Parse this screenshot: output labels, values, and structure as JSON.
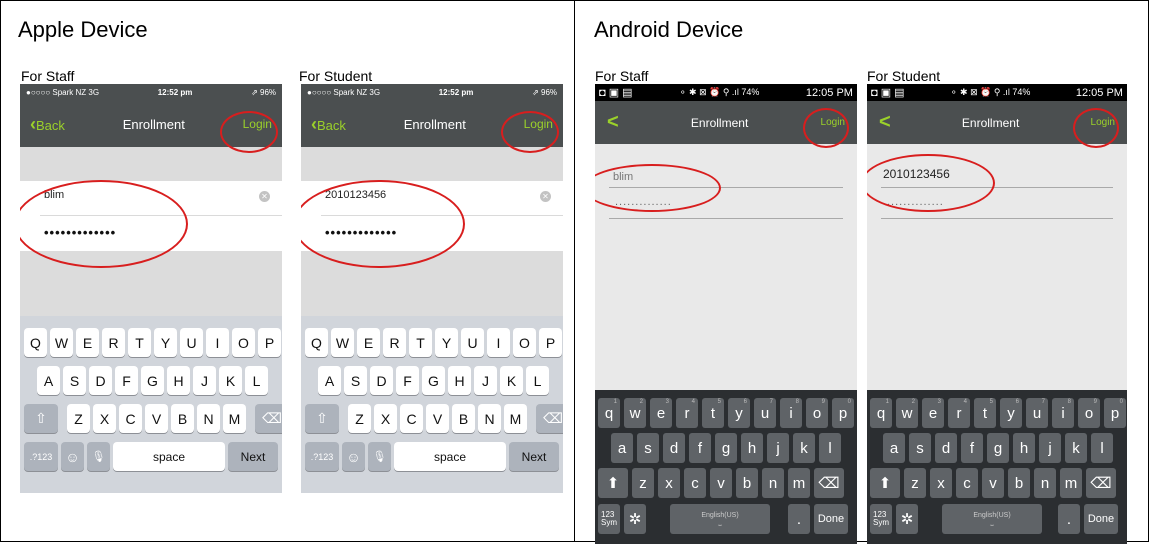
{
  "apple": {
    "title": "Apple Device",
    "staff": {
      "label": "For Staff",
      "statusbar": {
        "left": "●○○○○ Spark NZ  3G",
        "time": "12:52 pm",
        "right": "⇗ 96%"
      },
      "nav": {
        "back": "Back",
        "title": "Enrollment",
        "login": "Login"
      },
      "username": "blim",
      "password": "•••••••••••••",
      "keyboard": {
        "row1": [
          "Q",
          "W",
          "E",
          "R",
          "T",
          "Y",
          "U",
          "I",
          "O",
          "P"
        ],
        "row2": [
          "A",
          "S",
          "D",
          "F",
          "G",
          "H",
          "J",
          "K",
          "L"
        ],
        "row3": [
          "Z",
          "X",
          "C",
          "V",
          "B",
          "N",
          "M"
        ],
        "numkey": ".?123",
        "emoji": "☺",
        "mic": "🎙",
        "space": "space",
        "next": "Next",
        "shift": "⇧",
        "delete": "⌫"
      }
    },
    "student": {
      "label": "For Student",
      "statusbar": {
        "left": "●○○○○ Spark NZ  3G",
        "time": "12:52 pm",
        "right": "⇗ 96%"
      },
      "nav": {
        "back": "Back",
        "title": "Enrollment",
        "login": "Login"
      },
      "username": "2010123456",
      "password": "•••••••••••••",
      "keyboard": {
        "row1": [
          "Q",
          "W",
          "E",
          "R",
          "T",
          "Y",
          "U",
          "I",
          "O",
          "P"
        ],
        "row2": [
          "A",
          "S",
          "D",
          "F",
          "G",
          "H",
          "J",
          "K",
          "L"
        ],
        "row3": [
          "Z",
          "X",
          "C",
          "V",
          "B",
          "N",
          "M"
        ],
        "numkey": ".?123",
        "emoji": "☺",
        "mic": "🎙",
        "space": "space",
        "next": "Next",
        "shift": "⇧",
        "delete": "⌫"
      }
    }
  },
  "android": {
    "title": "Android Device",
    "staff": {
      "label": "For Staff",
      "statusbar": {
        "left": "◘ ▣ ▤",
        "icons": "⚬ ✱ ⊠ ⏰ ⚲ .ıl 74%",
        "time": "12:05 PM"
      },
      "nav": {
        "back": "<",
        "title": "Enrollment",
        "login": "Login"
      },
      "username": "blim",
      "password": "..............",
      "keyboard": {
        "row1": [
          "q",
          "w",
          "e",
          "r",
          "t",
          "y",
          "u",
          "i",
          "o",
          "p"
        ],
        "row1_hints": [
          "1",
          "2",
          "3",
          "4",
          "5",
          "6",
          "7",
          "8",
          "9",
          "0"
        ],
        "row2": [
          "a",
          "s",
          "d",
          "f",
          "g",
          "h",
          "j",
          "k",
          "l"
        ],
        "row3": [
          "z",
          "x",
          "c",
          "v",
          "b",
          "n",
          "m"
        ],
        "sym": "123\nSym",
        "gear": "✲",
        "space_label": "English(US)",
        "period": ".",
        "done": "Done",
        "shift": "⬆",
        "delete": "⌫"
      }
    },
    "student": {
      "label": "For Student",
      "statusbar": {
        "left": "◘ ▣ ▤",
        "icons": "⚬ ✱ ⊠ ⏰ ⚲ .ıl 74%",
        "time": "12:05 PM"
      },
      "nav": {
        "back": "<",
        "title": "Enrollment",
        "login": "Login"
      },
      "username": "2010123456",
      "password": "..............",
      "keyboard": {
        "row1": [
          "q",
          "w",
          "e",
          "r",
          "t",
          "y",
          "u",
          "i",
          "o",
          "p"
        ],
        "row1_hints": [
          "1",
          "2",
          "3",
          "4",
          "5",
          "6",
          "7",
          "8",
          "9",
          "0"
        ],
        "row2": [
          "a",
          "s",
          "d",
          "f",
          "g",
          "h",
          "j",
          "k",
          "l"
        ],
        "row3": [
          "z",
          "x",
          "c",
          "v",
          "b",
          "n",
          "m"
        ],
        "sym": "123\nSym",
        "gear": "✲",
        "space_label": "English(US)",
        "period": ".",
        "done": "Done",
        "shift": "⬆",
        "delete": "⌫"
      }
    }
  },
  "colors": {
    "accent": "#9bd12a",
    "navbar": "#4b4f50",
    "highlight": "#d81e1e"
  }
}
